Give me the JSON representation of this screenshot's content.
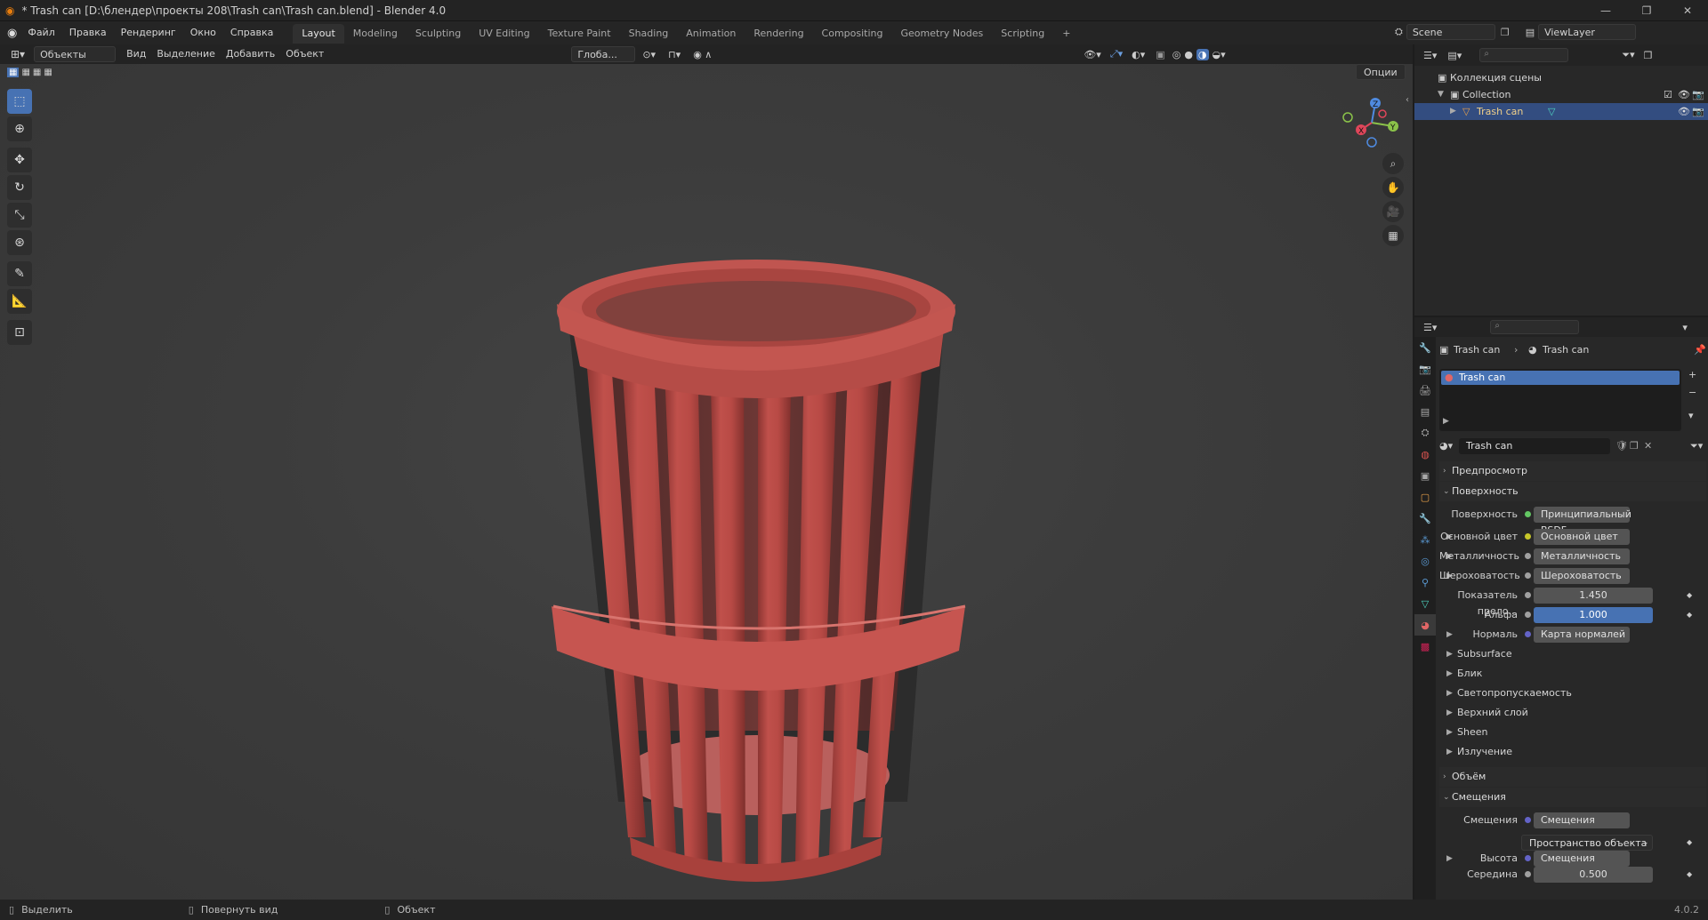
{
  "titlebar": {
    "title": "* Trash can [D:\\блендер\\проекты 208\\Trash can\\Trash can.blend] - Blender 4.0",
    "minimize": "—",
    "maximize": "❐",
    "close": "✕"
  },
  "menu": {
    "items": [
      "Файл",
      "Правка",
      "Рендеринг",
      "Окно",
      "Справка"
    ]
  },
  "workspaces": {
    "tabs": [
      "Layout",
      "Modeling",
      "Sculpting",
      "UV Editing",
      "Texture Paint",
      "Shading",
      "Animation",
      "Rendering",
      "Compositing",
      "Geometry Nodes",
      "Scripting"
    ],
    "active": "Layout",
    "add": "+"
  },
  "scene": {
    "name": "Scene",
    "view_layer": "ViewLayer"
  },
  "viewport_header": {
    "mode": "Объекты",
    "menus": [
      "Вид",
      "Выделение",
      "Добавить",
      "Объект"
    ],
    "orientation": "Глоба...",
    "options": "Опции"
  },
  "gizmo": {
    "x": "X",
    "y": "Y",
    "z": "Z"
  },
  "outliner": {
    "root": "Коллекция сцены",
    "collection": "Collection",
    "object": "Trash can"
  },
  "properties": {
    "breadcrumb": {
      "object": "Trash can",
      "material": "Trash can"
    },
    "slot": "Trash can",
    "material_name": "Trash can",
    "sections": {
      "preview": "Предпросмотр",
      "surface": "Поверхность",
      "volume": "Объём",
      "displacement": "Смещения"
    },
    "surface_label": "Поверхность",
    "surface_value": "Принципиальный BSDF",
    "rows": [
      {
        "label": "Основной цвет",
        "value": "Основной цвет"
      },
      {
        "label": "Металличность",
        "value": "Металличность"
      },
      {
        "label": "Шероховатость",
        "value": "Шероховатость"
      }
    ],
    "ior_label": "Показатель прело...",
    "ior_value": "1.450",
    "alpha_label": "Альфа",
    "alpha_value": "1.000",
    "normal_label": "Нормаль",
    "normal_value": "Карта нормалей",
    "subpanels": [
      "Subsurface",
      "Блик",
      "Светопропускаемость",
      "Верхний слой",
      "Sheen",
      "Излучение"
    ],
    "disp_label": "Смещения",
    "disp_value": "Смещения",
    "disp_space": "Пространство объекта",
    "height_label": "Высота",
    "height_value": "Смещения",
    "mid_label": "Середина",
    "mid_value": "0.500"
  },
  "statusbar": {
    "select": "Выделить",
    "rotate": "Повернуть вид",
    "object": "Объект",
    "version": "4.0.2"
  },
  "colors": {
    "accent": "#4772b3",
    "trash": "#b44a45",
    "viewport": "#3c3c3c"
  }
}
